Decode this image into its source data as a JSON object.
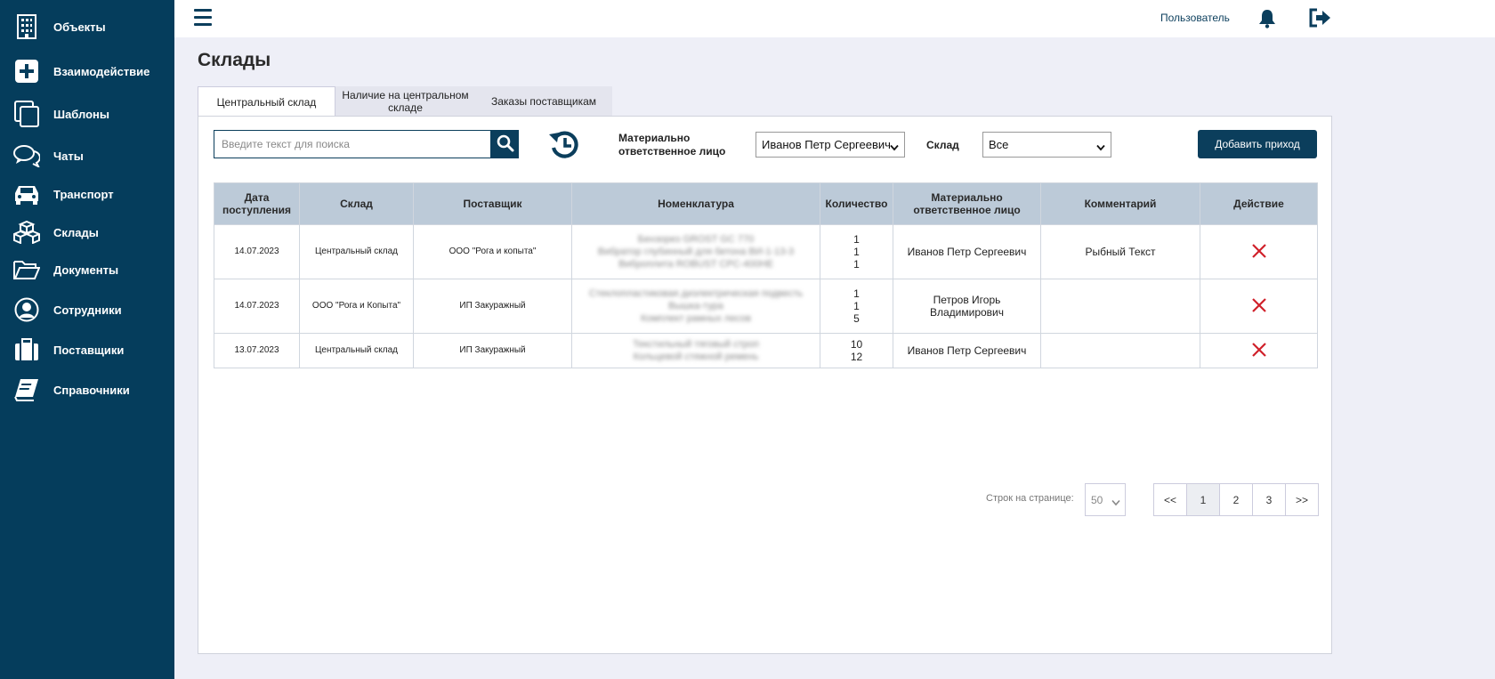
{
  "sidebar": {
    "items": [
      {
        "label": "Объекты",
        "icon": "building-icon"
      },
      {
        "label": "Взаимодействие",
        "icon": "plus-square-icon"
      },
      {
        "label": "Шаблоны",
        "icon": "copy-icon"
      },
      {
        "label": "Чаты",
        "icon": "chat-icon"
      },
      {
        "label": "Транспорт",
        "icon": "car-icon"
      },
      {
        "label": "Склады",
        "icon": "boxes-icon"
      },
      {
        "label": "Документы",
        "icon": "folder-icon"
      },
      {
        "label": "Сотрудники",
        "icon": "user-icon"
      },
      {
        "label": "Поставщики",
        "icon": "suitcase-icon"
      },
      {
        "label": "Справочники",
        "icon": "book-icon"
      }
    ]
  },
  "topbar": {
    "user_label": "Пользователь"
  },
  "page": {
    "title": "Склады"
  },
  "tabs": [
    {
      "label": "Центральный склад",
      "active": true
    },
    {
      "label": "Наличие на центральном складе",
      "active": false
    },
    {
      "label": "Заказы поставщикам",
      "active": false
    }
  ],
  "filters": {
    "search_placeholder": "Введите текст для поиска",
    "responsible_label": "Материально ответственное лицо",
    "responsible_value": "Иванов Петр Сергеевич",
    "warehouse_label": "Склад",
    "warehouse_value": "Все",
    "add_button": "Добавить приход"
  },
  "table": {
    "columns": [
      "Дата поступления",
      "Склад",
      "Поставщик",
      "Номенклатура",
      "Количество",
      "Материально ответственное лицо",
      "Комментарий",
      "Действие"
    ],
    "rows": [
      {
        "date": "14.07.2023",
        "warehouse": "Центральный склад",
        "supplier": "ООО \"Рога и копыта\"",
        "items": [
          "Бензорез GROST GC 770",
          "Вибратор глубинный для бетона ВИ-1-13-3",
          "Виброплита ROBUST CPC-400HE"
        ],
        "qty": [
          "1",
          "1",
          "1"
        ],
        "responsible": "Иванов Петр Сергеевич",
        "comment": "Рыбный Текст"
      },
      {
        "date": "14.07.2023",
        "warehouse": "ООО \"Рога и Копыта\"",
        "supplier": "ИП Закуражный",
        "items": [
          "Стеклопластиковая диэлектрическая подвесть",
          "Вышка-тура",
          "Комплект рамных лесов"
        ],
        "qty": [
          "1",
          "1",
          "5"
        ],
        "responsible": "Петров Игорь Владимирович",
        "comment": ""
      },
      {
        "date": "13.07.2023",
        "warehouse": "Центральный склад",
        "supplier": "ИП Закуражный",
        "items": [
          "Текстильный тяговый строп",
          "Кольцевой стяжной ремень"
        ],
        "qty": [
          "10",
          "12"
        ],
        "responsible": "Иванов Петр Сергеевич",
        "comment": ""
      }
    ]
  },
  "pagination": {
    "rows_label": "Строк на странице:",
    "rows_value": "50",
    "prev": "<<",
    "pages": [
      "1",
      "2",
      "3"
    ],
    "next": ">>",
    "current": "1"
  },
  "colors": {
    "primary": "#053d5c",
    "delete": "#d0202a",
    "header_bg": "#bccad8"
  }
}
